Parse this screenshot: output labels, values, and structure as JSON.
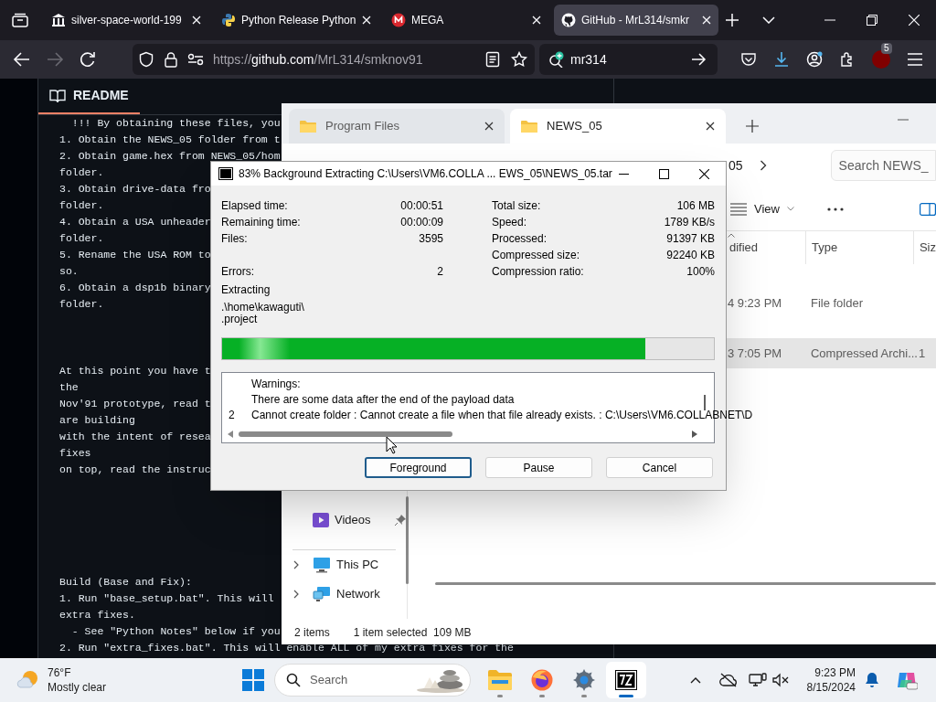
{
  "browser": {
    "tabs": [
      {
        "title": "silver-space-world-199",
        "selected": false
      },
      {
        "title": "Python Release Python",
        "selected": false
      },
      {
        "title": "MEGA",
        "selected": false
      },
      {
        "title": "GitHub - MrL314/smkr",
        "selected": true
      }
    ],
    "url": {
      "scheme": "https://",
      "host": "github.com",
      "path": "/MrL314/smknov91"
    },
    "search": {
      "value": "mr314"
    },
    "extensions_badge": "5"
  },
  "readme": {
    "title": "README",
    "blocks": [
      [
        "  !!! By obtaining these files, you",
        "1. Obtain the NEWS_05 folder from t",
        "2. Obtain game.hex from NEWS_05/hom",
        "folder.",
        "3. Obtain drive-data fro",
        "folder.",
        "4. Obtain a USA unheader",
        "folder.",
        "5. Rename the USA ROM to",
        "so.",
        "6. Obtain a dsp1b binary",
        "folder."
      ],
      [
        "At this point you have t",
        "the",
        "Nov'91 prototype, read t",
        "are building",
        "with the intent of resea",
        "fixes",
        "on top, read the instruc"
      ],
      [
        "Build (Base and Fix):",
        "1. Run \"base_setup.bat\". This will",
        "extra fixes.",
        "  - See \"Python Notes\" below if you",
        "2. Run \"extra_fixes.bat\". This will enable ALL of my extra fixes for the"
      ]
    ]
  },
  "explorer": {
    "tabs": [
      {
        "title": "Program Files",
        "selected": false
      },
      {
        "title": "NEWS_05",
        "selected": true
      }
    ],
    "breadcrumb": "05",
    "search": {
      "placeholder": "Search NEWS_"
    },
    "view_label": "View",
    "columns": [
      "dified",
      "Type",
      "Siz"
    ],
    "rows": [
      {
        "cells": [
          "4 9:23 PM",
          "File folder"
        ],
        "selected": false
      },
      {
        "cells": [
          "3 7:05 PM",
          "Compressed Archi...",
          "1"
        ],
        "selected": true
      }
    ],
    "sidebar": [
      {
        "label": "Videos",
        "pinned": true,
        "expandable": false
      },
      {
        "label": "This PC",
        "pinned": false,
        "expandable": true
      },
      {
        "label": "Network",
        "pinned": false,
        "expandable": true
      }
    ],
    "status": [
      "2 items",
      "1 item selected  109 MB"
    ]
  },
  "dialog": {
    "title": "83% Background Extracting C:\\Users\\VM6.COLLA ... EWS_05\\NEWS_05.tar",
    "stats": [
      {
        "left_label": "Elapsed time:",
        "left_value": "00:00:51",
        "right_label": "Total size:",
        "right_value": "106 MB"
      },
      {
        "left_label": "Remaining time:",
        "left_value": "00:00:09",
        "right_label": "Speed:",
        "right_value": "1789 KB/s"
      },
      {
        "left_label": "Files:",
        "left_value": "3595",
        "right_label": "Processed:",
        "right_value": "91397 KB"
      },
      {
        "right_label": "Compressed size:",
        "right_value": "92240 KB"
      },
      {
        "left_label": "Errors:",
        "left_value": "2",
        "right_label": "Compression ratio:",
        "right_value": "100%"
      }
    ],
    "status": "Extracting",
    "path": [
      ".\\home\\kawaguti\\",
      ".project"
    ],
    "progress": {
      "level": 0.86
    },
    "log": [
      {
        "text": "Warnings:"
      },
      {
        "text": "There are some data after the end of the payload data"
      },
      {
        "number": "2",
        "text": "Cannot create folder : Cannot create a file when that file already exists. : C:\\Users\\VM6.COLLABNET\\D"
      }
    ],
    "buttons": [
      {
        "label": "Foreground",
        "focused": true
      },
      {
        "label": "Pause",
        "focused": false
      },
      {
        "label": "Cancel",
        "focused": false
      }
    ]
  },
  "taskbar": {
    "weather": {
      "temperature": "76°F",
      "condition": "Mostly clear"
    },
    "search": {
      "placeholder": "Search"
    },
    "apps": [
      {
        "selected": false
      },
      {
        "selected": false
      },
      {
        "selected": false
      },
      {
        "selected": true
      }
    ],
    "time": "9:23 PM",
    "date": "8/15/2024"
  }
}
